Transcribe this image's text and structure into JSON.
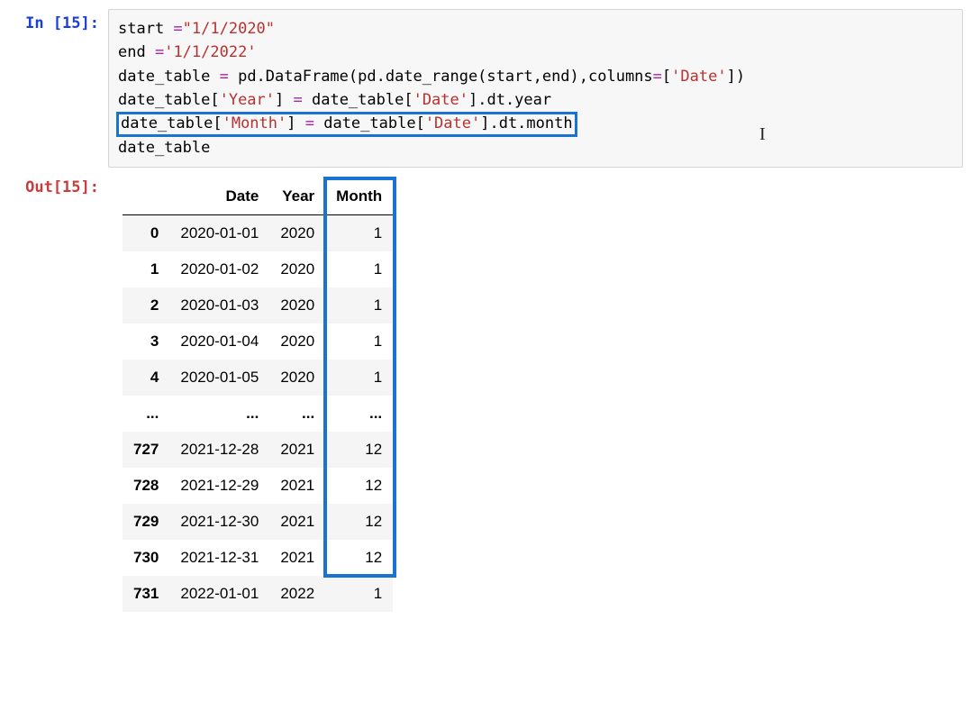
{
  "in_prompt": "In [15]:",
  "out_prompt": "Out[15]:",
  "code": {
    "l1_a": "start ",
    "l1_op": "=",
    "l1_str": "\"1/1/2020\"",
    "l2_a": "end ",
    "l2_op": "=",
    "l2_str": "'1/1/2022'",
    "l3_a": "date_table ",
    "l3_op": "=",
    "l3_b": " pd.DataFrame(pd.date_range(start,end),columns",
    "l3_op2": "=",
    "l3_c": "[",
    "l3_str": "'Date'",
    "l3_d": "])",
    "l4_a": "date_table[",
    "l4_str1": "'Year'",
    "l4_b": "] ",
    "l4_op": "=",
    "l4_c": " date_table[",
    "l4_str2": "'Date'",
    "l4_d": "].dt.year",
    "l5_a": "date_table[",
    "l5_str1": "'Month'",
    "l5_b": "] ",
    "l5_op": "=",
    "l5_c": " date_table[",
    "l5_str2": "'Date'",
    "l5_d": "].dt.month",
    "l6": "date_table"
  },
  "table": {
    "columns": [
      "Date",
      "Year",
      "Month"
    ],
    "ellipsis": "...",
    "rows": [
      {
        "idx": "0",
        "Date": "2020-01-01",
        "Year": "2020",
        "Month": "1"
      },
      {
        "idx": "1",
        "Date": "2020-01-02",
        "Year": "2020",
        "Month": "1"
      },
      {
        "idx": "2",
        "Date": "2020-01-03",
        "Year": "2020",
        "Month": "1"
      },
      {
        "idx": "3",
        "Date": "2020-01-04",
        "Year": "2020",
        "Month": "1"
      },
      {
        "idx": "4",
        "Date": "2020-01-05",
        "Year": "2020",
        "Month": "1"
      },
      {
        "idx": "...",
        "Date": "...",
        "Year": "...",
        "Month": "...",
        "ell": true
      },
      {
        "idx": "727",
        "Date": "2021-12-28",
        "Year": "2021",
        "Month": "12"
      },
      {
        "idx": "728",
        "Date": "2021-12-29",
        "Year": "2021",
        "Month": "12"
      },
      {
        "idx": "729",
        "Date": "2021-12-30",
        "Year": "2021",
        "Month": "12"
      },
      {
        "idx": "730",
        "Date": "2021-12-31",
        "Year": "2021",
        "Month": "12"
      },
      {
        "idx": "731",
        "Date": "2022-01-01",
        "Year": "2022",
        "Month": "1"
      }
    ]
  }
}
